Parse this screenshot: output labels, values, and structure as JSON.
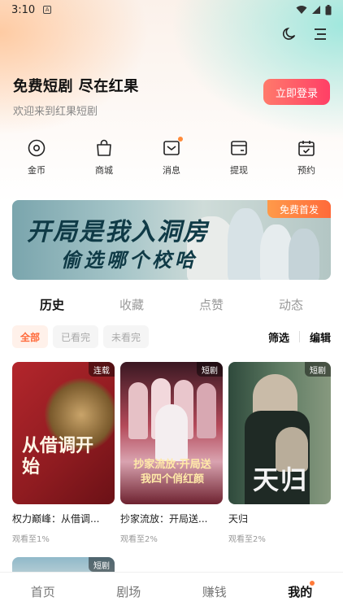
{
  "status": {
    "time": "3:10",
    "notif_letter": "A"
  },
  "header": {
    "title": "免费短剧 尽在红果",
    "subtitle": "欢迎来到红果短剧",
    "login_label": "立即登录",
    "icons": [
      "moon-icon",
      "menu-icon"
    ]
  },
  "shortcuts": [
    {
      "label": "金币",
      "icon": "coin-icon"
    },
    {
      "label": "商城",
      "icon": "shopping-bag-icon"
    },
    {
      "label": "消息",
      "icon": "message-icon",
      "has_dot": true
    },
    {
      "label": "提现",
      "icon": "wallet-icon"
    },
    {
      "label": "预约",
      "icon": "calendar-check-icon"
    }
  ],
  "banner": {
    "title_line1": "开局是我入洞房",
    "title_line2": "偷选哪个校哈",
    "badge": "免费首发"
  },
  "tabs": [
    {
      "label": "历史",
      "active": true
    },
    {
      "label": "收藏"
    },
    {
      "label": "点赞"
    },
    {
      "label": "动态"
    }
  ],
  "filters": {
    "chips": [
      {
        "label": "全部",
        "active": true
      },
      {
        "label": "已看完"
      },
      {
        "label": "未看完"
      }
    ],
    "filter_label": "筛选",
    "edit_label": "编辑"
  },
  "cards": [
    {
      "title": "权力巅峰：从借调...",
      "progress": "观看至1%",
      "tag": "连载",
      "poster_text": "从借调开始"
    },
    {
      "title": "抄家流放：开局送...",
      "progress": "观看至2%",
      "tag": "短剧",
      "poster_text": "抄家流放·开局送我四个俏红颜"
    },
    {
      "title": "天归",
      "progress": "观看至2%",
      "tag": "短剧",
      "poster_text": "天归"
    }
  ],
  "partial_card_tag": "短剧",
  "bottom_nav": [
    {
      "label": "首页"
    },
    {
      "label": "剧场"
    },
    {
      "label": "赚钱"
    },
    {
      "label": "我的",
      "active": true,
      "has_dot": true
    }
  ],
  "colors": {
    "accent": "#ff4f66",
    "chip_accent": "#ff6a3a",
    "dot": "#ff8a3a"
  }
}
